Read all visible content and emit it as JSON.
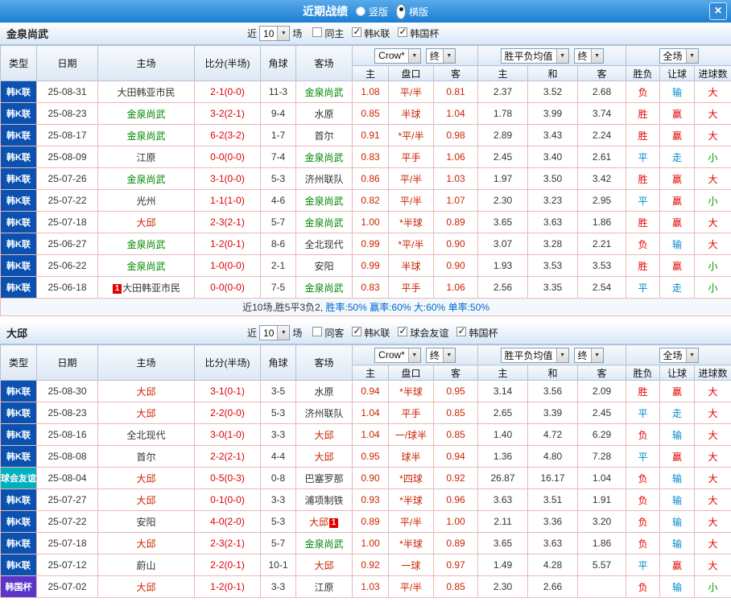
{
  "titlebar": {
    "title": "近期战绩",
    "vertical_label": "竖版",
    "horizontal_label": "横版",
    "vertical_selected": false,
    "horizontal_selected": true,
    "close_label": "×"
  },
  "cols": {
    "type": "类型",
    "date": "日期",
    "home": "主场",
    "score": "比分(半场)",
    "corner": "角球",
    "away": "客场",
    "bookmaker": "Crow*",
    "final": "终",
    "avg": "胜平负均值",
    "final2": "终",
    "scope": "全场",
    "h": "主",
    "handicap": "盘口",
    "a": "客",
    "h2": "主",
    "draw": "和",
    "a2": "客",
    "result": "胜负",
    "let": "让球",
    "goals": "进球数"
  },
  "value_colors": {
    "胜": "c-red",
    "负": "c-red",
    "平": "c-blue",
    "赢": "c-red",
    "输": "c-blue",
    "走": "c-blue",
    "大": "c-red",
    "小": "c-green"
  },
  "colors": {
    "league_k": "#0b52b0",
    "league_friendly": "#00b0bf",
    "league_cup": "#5a35c9",
    "team_focus_green": "#008800",
    "team_focus_red": "#cc2200",
    "score": "#e00000",
    "odds": "#cc2200",
    "win_red": "#e60000",
    "draw_blue": "#0088cc",
    "under_green": "#009900",
    "titlebar_blue": "#1b7ed2"
  },
  "section1": {
    "team": "金泉尚武",
    "filters": {
      "near_label": "近",
      "count": "10",
      "unit_label": "场",
      "checkboxes": [
        {
          "label": "同主",
          "checked": false
        },
        {
          "label": "韩K联",
          "checked": true
        },
        {
          "label": "韩国杯",
          "checked": true
        }
      ]
    },
    "rows": [
      {
        "league": "韩K联",
        "type": "k",
        "date": "25-08-31",
        "home": "大田韩亚市民",
        "homeColor": "n",
        "score": "2-1(0-0)",
        "corners": "11-3",
        "away": "金泉尚武",
        "awayColor": "g",
        "odds": [
          "1.08",
          "平/半",
          "0.81"
        ],
        "avg": [
          "2.37",
          "3.52",
          "2.68"
        ],
        "result": "负",
        "handicapResult": "输",
        "goals": "大"
      },
      {
        "league": "韩K联",
        "type": "k",
        "date": "25-08-23",
        "home": "金泉尚武",
        "homeColor": "g",
        "score": "3-2(2-1)",
        "corners": "9-4",
        "away": "水原",
        "awayColor": "n",
        "odds": [
          "0.85",
          "半球",
          "1.04"
        ],
        "avg": [
          "1.78",
          "3.99",
          "3.74"
        ],
        "result": "胜",
        "handicapResult": "赢",
        "goals": "大"
      },
      {
        "league": "韩K联",
        "type": "k",
        "date": "25-08-17",
        "home": "金泉尚武",
        "homeColor": "g",
        "score": "6-2(3-2)",
        "corners": "1-7",
        "away": "首尔",
        "awayColor": "n",
        "odds": [
          "0.91",
          "*平/半",
          "0.98"
        ],
        "avg": [
          "2.89",
          "3.43",
          "2.24"
        ],
        "result": "胜",
        "handicapResult": "赢",
        "goals": "大"
      },
      {
        "league": "韩K联",
        "type": "k",
        "date": "25-08-09",
        "home": "江原",
        "homeColor": "n",
        "score": "0-0(0-0)",
        "corners": "7-4",
        "away": "金泉尚武",
        "awayColor": "g",
        "odds": [
          "0.83",
          "平手",
          "1.06"
        ],
        "avg": [
          "2.45",
          "3.40",
          "2.61"
        ],
        "result": "平",
        "handicapResult": "走",
        "goals": "小"
      },
      {
        "league": "韩K联",
        "type": "k",
        "date": "25-07-26",
        "home": "金泉尚武",
        "homeColor": "g",
        "score": "3-1(0-0)",
        "corners": "5-3",
        "away": "济州联队",
        "awayColor": "n",
        "odds": [
          "0.86",
          "平/半",
          "1.03"
        ],
        "avg": [
          "1.97",
          "3.50",
          "3.42"
        ],
        "result": "胜",
        "handicapResult": "赢",
        "goals": "大"
      },
      {
        "league": "韩K联",
        "type": "k",
        "date": "25-07-22",
        "home": "光州",
        "homeColor": "n",
        "score": "1-1(1-0)",
        "corners": "4-6",
        "away": "金泉尚武",
        "awayColor": "g",
        "odds": [
          "0.82",
          "平/半",
          "1.07"
        ],
        "avg": [
          "2.30",
          "3.23",
          "2.95"
        ],
        "result": "平",
        "handicapResult": "赢",
        "goals": "小"
      },
      {
        "league": "韩K联",
        "type": "k",
        "date": "25-07-18",
        "home": "大邱",
        "homeColor": "r",
        "score": "2-3(2-1)",
        "corners": "5-7",
        "away": "金泉尚武",
        "awayColor": "g",
        "odds": [
          "1.00",
          "*半球",
          "0.89"
        ],
        "avg": [
          "3.65",
          "3.63",
          "1.86"
        ],
        "result": "胜",
        "handicapResult": "赢",
        "goals": "大"
      },
      {
        "league": "韩K联",
        "type": "k",
        "date": "25-06-27",
        "home": "金泉尚武",
        "homeColor": "g",
        "score": "1-2(0-1)",
        "corners": "8-6",
        "away": "全北现代",
        "awayColor": "n",
        "odds": [
          "0.99",
          "*平/半",
          "0.90"
        ],
        "avg": [
          "3.07",
          "3.28",
          "2.21"
        ],
        "result": "负",
        "handicapResult": "输",
        "goals": "大"
      },
      {
        "league": "韩K联",
        "type": "k",
        "date": "25-06-22",
        "home": "金泉尚武",
        "homeColor": "g",
        "score": "1-0(0-0)",
        "corners": "2-1",
        "away": "安阳",
        "awayColor": "n",
        "odds": [
          "0.99",
          "半球",
          "0.90"
        ],
        "avg": [
          "1.93",
          "3.53",
          "3.53"
        ],
        "result": "胜",
        "handicapResult": "赢",
        "goals": "小"
      },
      {
        "league": "韩K联",
        "type": "k",
        "date": "25-06-18",
        "home": "大田韩亚市民",
        "homeColor": "n",
        "homeBadge": "before",
        "score": "0-0(0-0)",
        "corners": "7-5",
        "away": "金泉尚武",
        "awayColor": "g",
        "odds": [
          "0.83",
          "平手",
          "1.06"
        ],
        "avg": [
          "2.56",
          "3.35",
          "2.54"
        ],
        "result": "平",
        "handicapResult": "走",
        "goals": "小"
      }
    ],
    "summary": [
      {
        "text": "近10场,胜5平3负2, ",
        "color": "dark"
      },
      {
        "text": "胜率:50% ",
        "color": "blue"
      },
      {
        "text": "赢率:60% ",
        "color": "blue"
      },
      {
        "text": "大:60% ",
        "color": "blue"
      },
      {
        "text": "单率:50%",
        "color": "blue"
      }
    ]
  },
  "section2": {
    "team": "大邱",
    "filters": {
      "near_label": "近",
      "count": "10",
      "unit_label": "场",
      "checkboxes": [
        {
          "label": "同客",
          "checked": false
        },
        {
          "label": "韩K联",
          "checked": true
        },
        {
          "label": "球会友谊",
          "checked": true
        },
        {
          "label": "韩国杯",
          "checked": true
        }
      ]
    },
    "rows": [
      {
        "league": "韩K联",
        "type": "k",
        "date": "25-08-30",
        "home": "大邱",
        "homeColor": "r",
        "score": "3-1(0-1)",
        "corners": "3-5",
        "away": "水原",
        "awayColor": "n",
        "odds": [
          "0.94",
          "*半球",
          "0.95"
        ],
        "avg": [
          "3.14",
          "3.56",
          "2.09"
        ],
        "result": "胜",
        "handicapResult": "赢",
        "goals": "大"
      },
      {
        "league": "韩K联",
        "type": "k",
        "date": "25-08-23",
        "home": "大邱",
        "homeColor": "r",
        "score": "2-2(0-0)",
        "corners": "5-3",
        "away": "济州联队",
        "awayColor": "n",
        "odds": [
          "1.04",
          "平手",
          "0.85"
        ],
        "avg": [
          "2.65",
          "3.39",
          "2.45"
        ],
        "result": "平",
        "handicapResult": "走",
        "goals": "大"
      },
      {
        "league": "韩K联",
        "type": "k",
        "date": "25-08-16",
        "home": "全北现代",
        "homeColor": "n",
        "score": "3-0(1-0)",
        "corners": "3-3",
        "away": "大邱",
        "awayColor": "r",
        "odds": [
          "1.04",
          "一/球半",
          "0.85"
        ],
        "avg": [
          "1.40",
          "4.72",
          "6.29"
        ],
        "result": "负",
        "handicapResult": "输",
        "goals": "大"
      },
      {
        "league": "韩K联",
        "type": "k",
        "date": "25-08-08",
        "home": "首尔",
        "homeColor": "n",
        "score": "2-2(2-1)",
        "corners": "4-4",
        "away": "大邱",
        "awayColor": "r",
        "odds": [
          "0.95",
          "球半",
          "0.94"
        ],
        "avg": [
          "1.36",
          "4.80",
          "7.28"
        ],
        "result": "平",
        "handicapResult": "赢",
        "goals": "大"
      },
      {
        "league": "球会友谊",
        "type": "friendly",
        "date": "25-08-04",
        "home": "大邱",
        "homeColor": "r",
        "score": "0-5(0-3)",
        "corners": "0-8",
        "away": "巴塞罗那",
        "awayColor": "n",
        "odds": [
          "0.90",
          "*四球",
          "0.92"
        ],
        "avg": [
          "26.87",
          "16.17",
          "1.04"
        ],
        "result": "负",
        "handicapResult": "输",
        "goals": "大"
      },
      {
        "league": "韩K联",
        "type": "k",
        "date": "25-07-27",
        "home": "大邱",
        "homeColor": "r",
        "score": "0-1(0-0)",
        "corners": "3-3",
        "away": "浦项制铁",
        "awayColor": "n",
        "odds": [
          "0.93",
          "*半球",
          "0.96"
        ],
        "avg": [
          "3.63",
          "3.51",
          "1.91"
        ],
        "result": "负",
        "handicapResult": "输",
        "goals": "大"
      },
      {
        "league": "韩K联",
        "type": "k",
        "date": "25-07-22",
        "home": "安阳",
        "homeColor": "n",
        "score": "4-0(2-0)",
        "corners": "5-3",
        "away": "大邱",
        "awayColor": "r",
        "awayBadge": "after",
        "odds": [
          "0.89",
          "平/半",
          "1.00"
        ],
        "avg": [
          "2.11",
          "3.36",
          "3.20"
        ],
        "result": "负",
        "handicapResult": "输",
        "goals": "大"
      },
      {
        "league": "韩K联",
        "type": "k",
        "date": "25-07-18",
        "home": "大邱",
        "homeColor": "r",
        "score": "2-3(2-1)",
        "corners": "5-7",
        "away": "金泉尚武",
        "awayColor": "g",
        "odds": [
          "1.00",
          "*半球",
          "0.89"
        ],
        "avg": [
          "3.65",
          "3.63",
          "1.86"
        ],
        "result": "负",
        "handicapResult": "输",
        "goals": "大"
      },
      {
        "league": "韩K联",
        "type": "k",
        "date": "25-07-12",
        "home": "蔚山",
        "homeColor": "n",
        "score": "2-2(0-1)",
        "corners": "10-1",
        "away": "大邱",
        "awayColor": "r",
        "odds": [
          "0.92",
          "一球",
          "0.97"
        ],
        "avg": [
          "1.49",
          "4.28",
          "5.57"
        ],
        "result": "平",
        "handicapResult": "赢",
        "goals": "大"
      },
      {
        "league": "韩国杯",
        "type": "cup",
        "date": "25-07-02",
        "home": "大邱",
        "homeColor": "r",
        "score": "1-2(0-1)",
        "corners": "3-3",
        "away": "江原",
        "awayColor": "n",
        "odds": [
          "1.03",
          "平/半",
          "0.85"
        ],
        "avg": [
          "2.30",
          "2.66",
          ""
        ],
        "result": "负",
        "handicapResult": "输",
        "goals": "小"
      }
    ]
  }
}
